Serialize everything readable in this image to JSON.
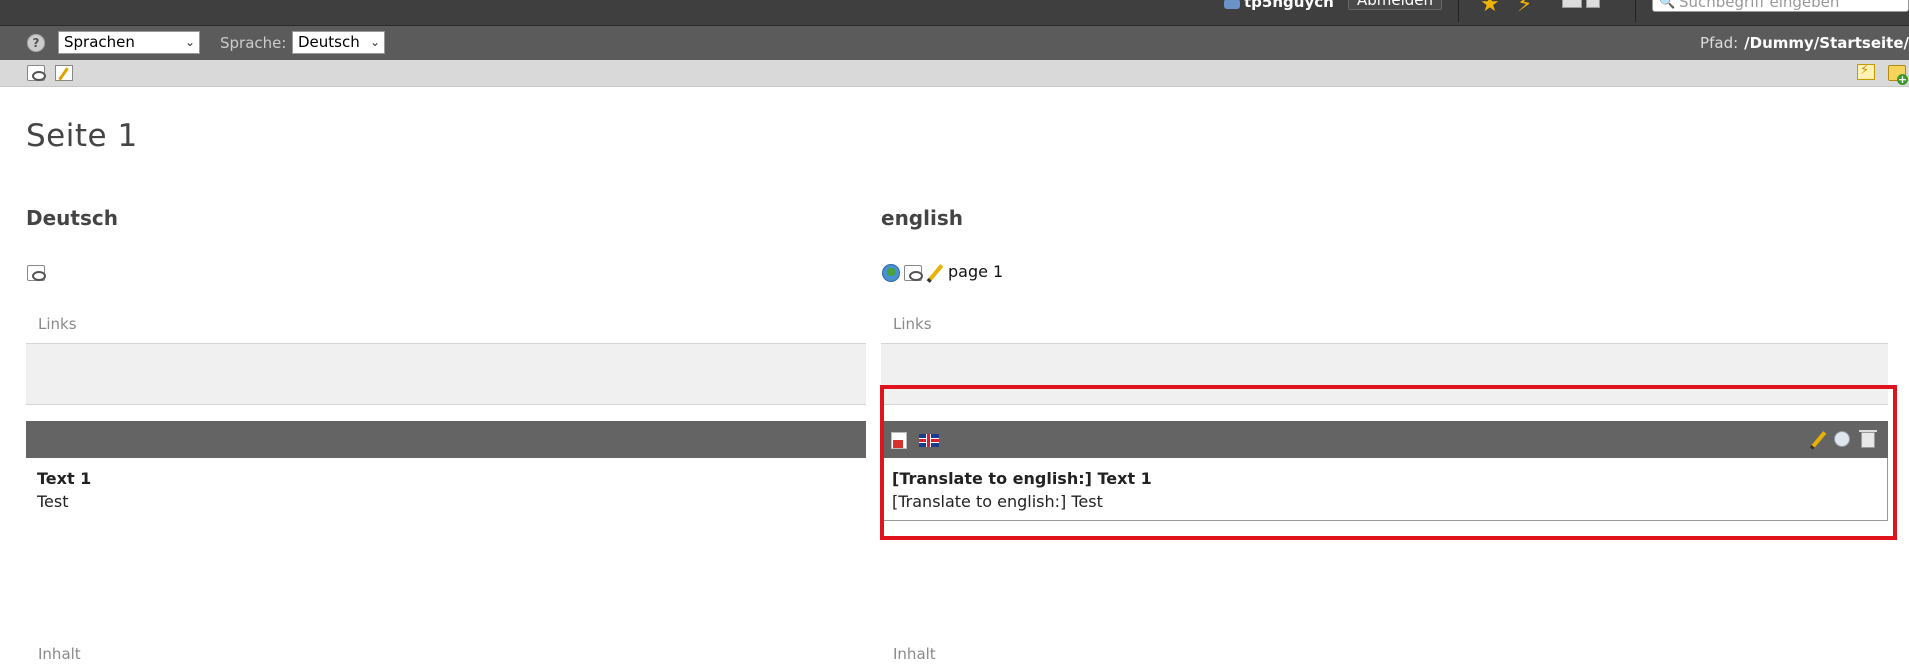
{
  "topbar": {
    "username": "tp5nguych",
    "logout_label": "Abmelden",
    "search_placeholder": "Suchbegriff eingeben"
  },
  "langbar": {
    "help_glyph": "?",
    "select_value": "Sprachen",
    "sprache_label": "Sprache:",
    "sprache_value": "Deutsch",
    "path_label": "Pfad:",
    "path_value": "/Dummy/Startseite/"
  },
  "page": {
    "title": "Seite 1"
  },
  "left": {
    "title": "Deutsch",
    "section_top": "Links",
    "section_bottom": "Inhalt",
    "ce_header": "Text 1",
    "ce_body": "Test"
  },
  "right": {
    "title": "english",
    "page_label": "page 1",
    "section_top": "Links",
    "section_bottom": "Inhalt",
    "ce_header": "[Translate to english:] Text 1",
    "ce_body": "[Translate to english:] Test"
  },
  "colors": {
    "highlight": "#e0141c",
    "topbar": "#3f3f3f",
    "langbar": "#5b5b5b"
  }
}
